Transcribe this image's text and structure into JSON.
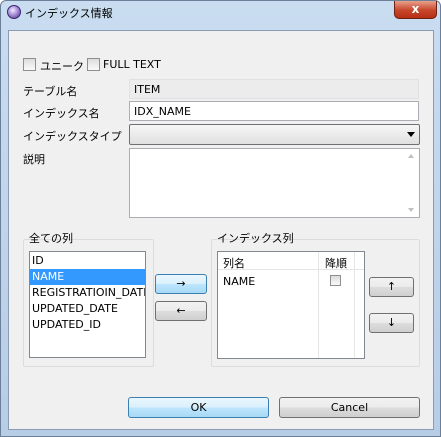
{
  "window": {
    "title": "インデックス情報",
    "close_glyph": "x"
  },
  "options": {
    "unique_label": "ユニーク",
    "unique_checked": false,
    "fulltext_label": "FULL TEXT",
    "fulltext_checked": false
  },
  "form": {
    "table_name_label": "テーブル名",
    "table_name_value": "ITEM",
    "index_name_label": "インデックス名",
    "index_name_value": "IDX_NAME",
    "index_type_label": "インデックスタイプ",
    "index_type_value": "",
    "description_label": "説明",
    "description_value": ""
  },
  "all_columns": {
    "label": "全ての列",
    "items": [
      "ID",
      "NAME",
      "REGISTRATIOIN_DATE",
      "UPDATED_DATE",
      "UPDATED_ID"
    ],
    "selected_index": 1
  },
  "transfer": {
    "add_label": "→",
    "remove_label": "←"
  },
  "index_columns": {
    "label": "インデックス列",
    "headers": {
      "name": "列名",
      "desc": "降順"
    },
    "rows": [
      {
        "name": "NAME",
        "desc": false
      }
    ]
  },
  "order": {
    "up_label": "↑",
    "down_label": "↓"
  },
  "footer": {
    "ok_label": "OK",
    "cancel_label": "Cancel"
  }
}
